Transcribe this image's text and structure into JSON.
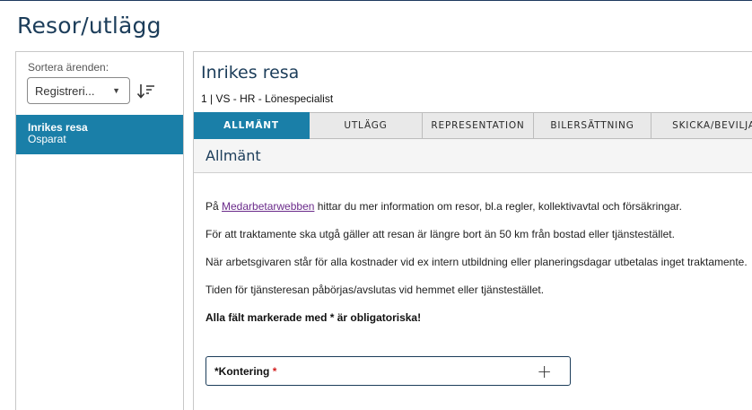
{
  "page": {
    "title": "Resor/utlägg"
  },
  "sidebar": {
    "sort_label": "Sortera ärenden:",
    "sort_selected": "Registreri...",
    "sort_order_icon": "sort-descending-icon",
    "cases": [
      {
        "title": "Inrikes resa",
        "status": "Osparat"
      }
    ]
  },
  "case": {
    "title": "Inrikes resa",
    "subtitle": "1 | VS - HR - Lönespecialist",
    "tabs": [
      {
        "label": "ALLMÄNT",
        "active": true
      },
      {
        "label": "UTLÄGG",
        "active": false
      },
      {
        "label": "REPRESENTATION",
        "active": false
      },
      {
        "label": "BILERSÄTTNING",
        "active": false
      },
      {
        "label": "SKICKA/BEVILJA",
        "active": false
      }
    ],
    "section_title": "Allmänt",
    "info": {
      "line1_prefix": "På ",
      "line1_link": "Medarbetarwebben",
      "line1_suffix": " hittar du mer information om resor, bl.a regler, kollektivavtal och försäkringar.",
      "line2": "För att traktamente ska utgå gäller att resan är längre bort än 50 km från bostad eller tjänstestället.",
      "line3": "När arbetsgivaren står för alla kostnader vid ex intern utbildning eller planeringsdagar utbetalas inget traktamente.",
      "line4": "Tiden för tjänsteresan påbörjas/avslutas vid hemmet eller tjänstestället.",
      "line5": "Alla fält markerade med * är obligatoriska!"
    },
    "accordion": {
      "label": "*Kontering",
      "required_mark": "*",
      "expand_icon": "plus-icon"
    }
  },
  "colors": {
    "accent": "#1a7fa8",
    "title": "#1c3d5a",
    "link": "#6a2a8a",
    "required": "#d21f1f"
  }
}
